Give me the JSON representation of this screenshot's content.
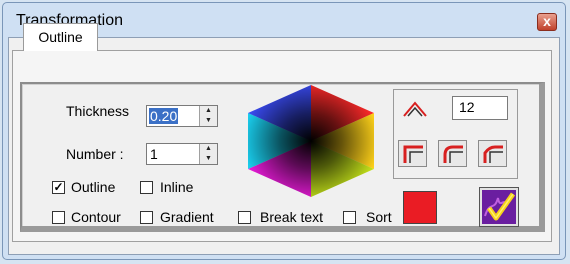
{
  "window": {
    "title": "Transformation",
    "close_label": "x"
  },
  "tabs": [
    {
      "label": "Outline"
    }
  ],
  "fields": {
    "thickness": {
      "label": "Thickness",
      "value": "0.20"
    },
    "number": {
      "label": "Number :",
      "value": "1"
    }
  },
  "checkboxes": [
    {
      "label": "Outline",
      "checked": true,
      "check_mark": "✓"
    },
    {
      "label": "Inline",
      "checked": false
    },
    {
      "label": "Contour",
      "checked": false
    },
    {
      "label": "Gradient",
      "checked": false
    },
    {
      "label": "Break text",
      "checked": false
    },
    {
      "label": "Sort",
      "checked": false
    }
  ],
  "corner": {
    "angle_value": "12",
    "icon": "angle-icon",
    "styles": [
      "square-corner-icon",
      "rounded-corner-icon",
      "beveled-corner-icon"
    ]
  },
  "colors": {
    "outline_color": "#ea1c24",
    "accent": "#ea1c24",
    "apply_bg": "#6a1ea0"
  }
}
